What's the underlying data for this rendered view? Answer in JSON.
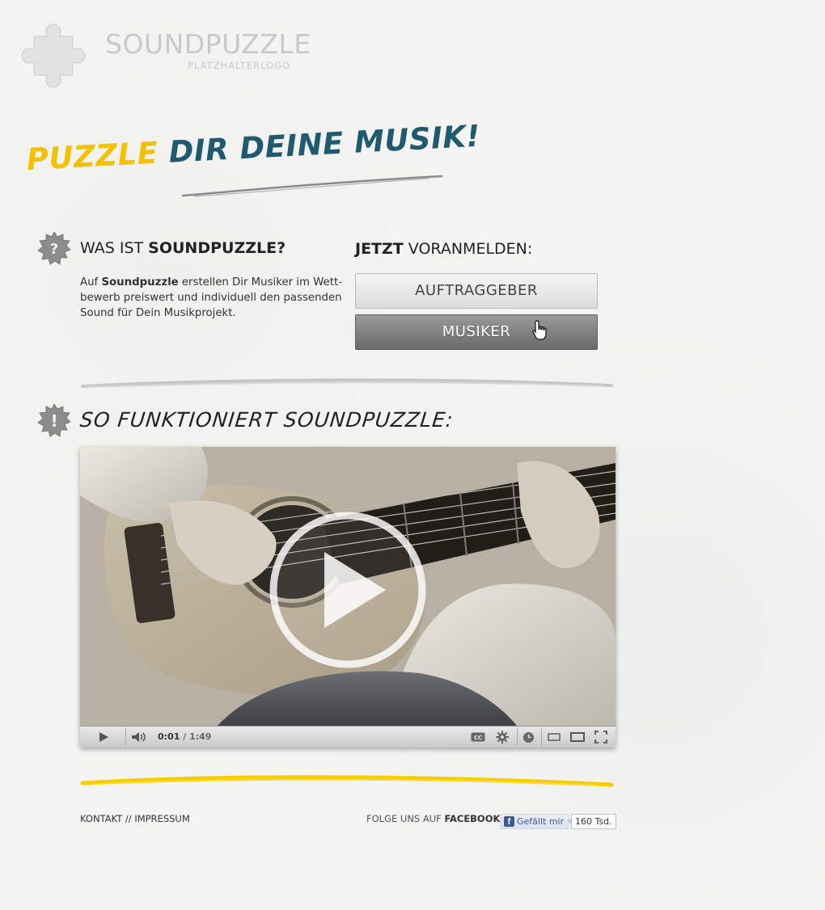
{
  "logo": {
    "title": "SOUNDPUZZLE",
    "subtitle": "PLATZHALTERLOGO"
  },
  "tagline": {
    "part1": "PUZZLE",
    "part2": "DIR DEINE MUSIK!"
  },
  "about": {
    "title_prefix": "WAS IST ",
    "title_bold": "SOUNDPUZZLE?",
    "text_prefix": "Auf ",
    "text_bold": "Soundpuzzle",
    "text_rest": " erstellen Dir Musiker im Wett-bewerb preiswert und individuell den passenden Sound für Dein Musikprojekt."
  },
  "signup": {
    "title_bold": "JETZT",
    "title_rest": " VORANMELDEN:",
    "client_label": "AUFTRAGGEBER",
    "musician_label": "MUSIKER"
  },
  "how": {
    "title": "SO FUNKTIONIERT SOUNDPUZZLE:"
  },
  "video": {
    "current_time": "0:01",
    "duration": "1:49"
  },
  "footer": {
    "contact": "KONTAKT",
    "separator": " // ",
    "imprint": "IMPRESSUM",
    "follow_prefix": "FOLGE UNS AUF ",
    "follow_bold": "FACEBOOK",
    "follow_suffix": ":",
    "like_label": "Gefällt mir",
    "like_count": "160 Tsd."
  },
  "colors": {
    "tagline_yellow": "#f2c200",
    "tagline_blue": "#1f5a6e",
    "facebook": "#3b5998"
  }
}
